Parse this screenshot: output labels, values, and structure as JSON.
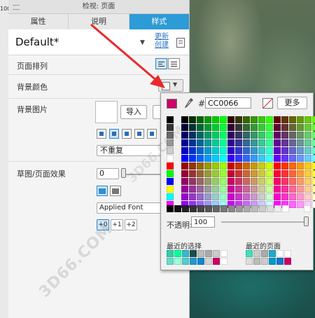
{
  "ruler": {
    "number": "100"
  },
  "panel": {
    "title": "检视: 页面",
    "tabs": [
      {
        "label": "属性",
        "active": false
      },
      {
        "label": "说明",
        "active": false
      },
      {
        "label": "样式",
        "active": true
      }
    ],
    "style_name": "Default*",
    "style_dropdown_arrow": "▼",
    "new_style_link": "更新\n创建",
    "page_arrangement_label": "页面排列",
    "bg_color_label": "背景颜色",
    "bg_image_label": "背景图片",
    "import_button": "导入",
    "repeat_select": "不重复",
    "sketch_effect_label": "草图/页面效果",
    "sketch_value": "0",
    "font_select": "Applied Font",
    "font_offset_buttons": [
      "+0",
      "+1",
      "+2"
    ]
  },
  "color_picker": {
    "current_color": "#cc0066",
    "hash": "#",
    "hex_value": "CC0066",
    "more_button": "更多",
    "opacity_label": "不透明:",
    "opacity_value": "100",
    "recent_label": "最近的选择",
    "page_label": "最近的页面",
    "basic_colors": [
      "#000000",
      "#333333",
      "#666666",
      "#999999",
      "#cccccc",
      "#ffffff",
      "#ff0000",
      "#00ff00",
      "#0000ff",
      "#ffff00",
      "#00ffff",
      "#ff00ff"
    ],
    "recent_colors": [
      "#33ccaa",
      "#00ff99",
      "#33bbcc",
      "#1a4d4d",
      "#bbbbbb",
      "#aaaaaa",
      "#cccccc",
      "#ffffff",
      "#66ddcc",
      "#99ffdd",
      "#55cccc",
      "#2299cc",
      "#1188cc",
      "#d4d4d4",
      "#cc0066",
      "#ffffff"
    ],
    "page_colors": [
      "#44ddbb",
      "#cccccc",
      "#aaaaaa",
      "#22aacc",
      "#ffffff",
      "#ffffff",
      "#dddddd",
      "#bbbbbb",
      "#cccccc",
      "#0099cc",
      "#1177cc",
      "#cc0066"
    ]
  },
  "watermark": "3D66.COM"
}
